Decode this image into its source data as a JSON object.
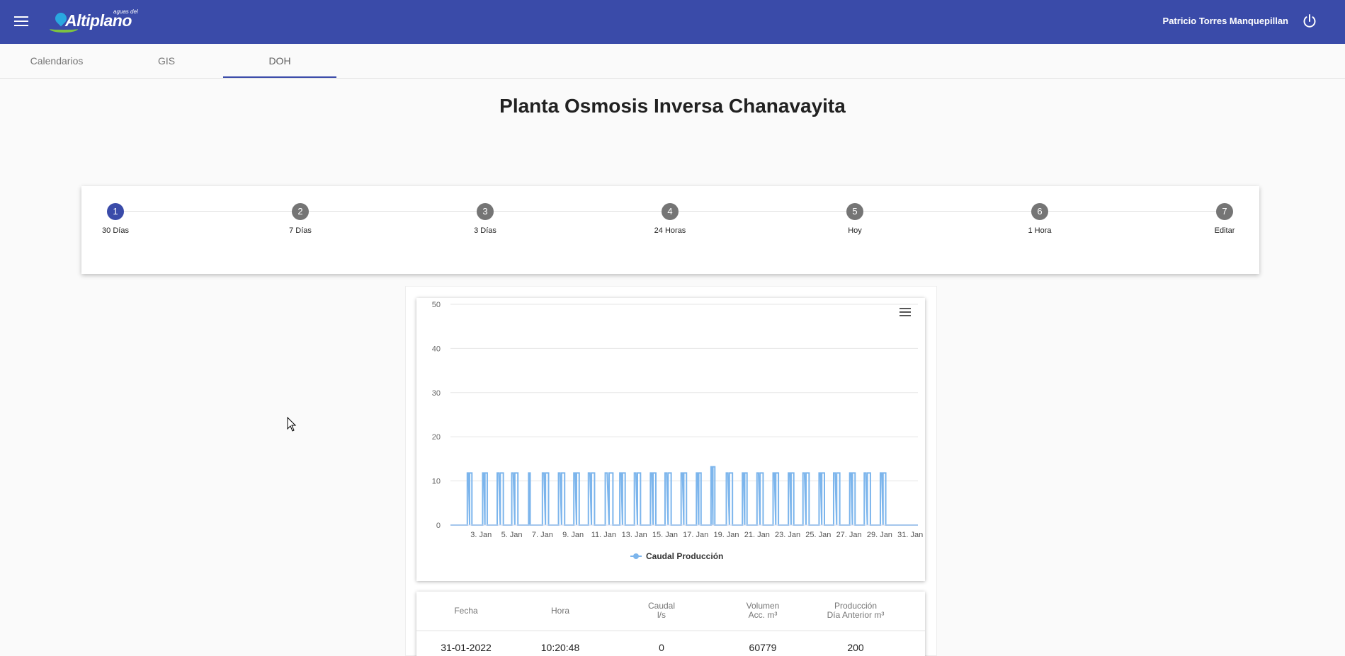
{
  "header": {
    "logo_small": "aguas del",
    "logo_text": "Altiplano",
    "user_name": "Patricio Torres Manquepillan"
  },
  "tabs": [
    {
      "label": "Calendarios"
    },
    {
      "label": "GIS"
    },
    {
      "label": "DOH",
      "active": true
    }
  ],
  "page_title": "Planta Osmosis Inversa Chanavayita",
  "steps": [
    {
      "num": "1",
      "label": "30 Días",
      "active": true
    },
    {
      "num": "2",
      "label": "7 Días"
    },
    {
      "num": "3",
      "label": "3 Días"
    },
    {
      "num": "4",
      "label": "24 Horas"
    },
    {
      "num": "5",
      "label": "Hoy"
    },
    {
      "num": "6",
      "label": "1 Hora"
    },
    {
      "num": "7",
      "label": "Editar"
    }
  ],
  "chart_data": {
    "type": "area",
    "series": [
      {
        "name": "Caudal Producción",
        "color": "#7cb5ec"
      }
    ],
    "y_ticks": [
      0,
      10,
      20,
      30,
      40,
      50
    ],
    "ylim": [
      0,
      50
    ],
    "x_ticks": [
      "3. Jan",
      "5. Jan",
      "7. Jan",
      "9. Jan",
      "11. Jan",
      "13. Jan",
      "15. Jan",
      "17. Jan",
      "19. Jan",
      "21. Jan",
      "23. Jan",
      "25. Jan",
      "27. Jan",
      "29. Jan",
      "31. Jan"
    ],
    "x_range_days": [
      1,
      31.5
    ],
    "pulses": [
      {
        "start": 2.1,
        "end": 2.4,
        "value": 11.8
      },
      {
        "start": 3.1,
        "end": 3.4,
        "value": 11.8
      },
      {
        "start": 4.05,
        "end": 4.45,
        "value": 11.8
      },
      {
        "start": 5.0,
        "end": 5.4,
        "value": 11.8
      },
      {
        "start": 6.1,
        "end": 6.2,
        "value": 11.8
      },
      {
        "start": 7.0,
        "end": 7.4,
        "value": 11.8
      },
      {
        "start": 8.05,
        "end": 8.45,
        "value": 11.8
      },
      {
        "start": 9.05,
        "end": 9.4,
        "value": 11.8
      },
      {
        "start": 10.0,
        "end": 10.4,
        "value": 11.8
      },
      {
        "start": 11.1,
        "end": 11.6,
        "value": 11.8
      },
      {
        "start": 12.05,
        "end": 12.4,
        "value": 11.8
      },
      {
        "start": 13.0,
        "end": 13.4,
        "value": 11.8
      },
      {
        "start": 14.05,
        "end": 14.4,
        "value": 11.8
      },
      {
        "start": 15.0,
        "end": 15.4,
        "value": 11.8
      },
      {
        "start": 16.05,
        "end": 16.4,
        "value": 11.8
      },
      {
        "start": 17.05,
        "end": 17.35,
        "value": 11.8
      },
      {
        "start": 18.0,
        "end": 18.25,
        "value": 13.2
      },
      {
        "start": 19.0,
        "end": 19.4,
        "value": 11.8
      },
      {
        "start": 20.05,
        "end": 20.35,
        "value": 11.8
      },
      {
        "start": 21.0,
        "end": 21.4,
        "value": 11.8
      },
      {
        "start": 22.05,
        "end": 22.4,
        "value": 11.8
      },
      {
        "start": 23.05,
        "end": 23.4,
        "value": 11.8
      },
      {
        "start": 24.0,
        "end": 24.4,
        "value": 11.8
      },
      {
        "start": 25.05,
        "end": 25.4,
        "value": 11.8
      },
      {
        "start": 26.0,
        "end": 26.4,
        "value": 11.8
      },
      {
        "start": 27.05,
        "end": 27.4,
        "value": 11.8
      },
      {
        "start": 28.0,
        "end": 28.4,
        "value": 11.8
      },
      {
        "start": 29.05,
        "end": 29.4,
        "value": 11.8
      }
    ]
  },
  "table": {
    "headers": [
      {
        "line1": "Fecha",
        "line2": ""
      },
      {
        "line1": "Hora",
        "line2": ""
      },
      {
        "line1": "Caudal",
        "line2": "l/s"
      },
      {
        "line1": "Volumen",
        "line2": "Acc. m³"
      },
      {
        "line1": "Producción",
        "line2": "Día Anterior m³"
      }
    ],
    "rows": [
      [
        "31-01-2022",
        "10:20:48",
        "0",
        "60779",
        "200"
      ]
    ]
  }
}
